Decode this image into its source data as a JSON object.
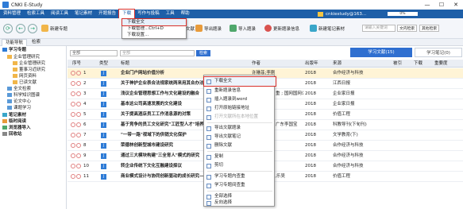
{
  "window": {
    "title": "CNKI E-Study",
    "minimize": "—",
    "maximize": "☐",
    "close": "✕"
  },
  "menu": {
    "items": [
      "资料管理",
      "检索工具",
      "阅读工具",
      "笔记素材",
      "开题报告",
      "下载",
      "写作与投稿",
      "工具",
      "帮助"
    ],
    "user": "cnkiestudy@163...",
    "progress": "0%"
  },
  "download_menu": {
    "items": [
      "下载全文",
      "下载管理...Ctrl+D",
      "下载设置..."
    ]
  },
  "toolbar": {
    "buttons": [
      "新建专题",
      "新建文件夹",
      "添加文献",
      "导入题录",
      "导出题录",
      "查找重复",
      "检索",
      "导出题录",
      "导入题录",
      "更新题录信息",
      "新建笔记素材"
    ],
    "search_placeholder": "请输入关键词",
    "search_btn": "文内检索",
    "other_search": "其他检索"
  },
  "tabs": {
    "items": [
      "功能导航",
      "检索"
    ]
  },
  "sidebar": {
    "items": [
      "学习专题",
      "企业管理研究",
      "企业管理研究",
      "董事习近研究",
      "网页资料",
      "已读文献",
      "全文检索",
      "科学知识图谱",
      "论文中心",
      "课题学习",
      "笔记素材",
      "临时阅读",
      "浏览器导入",
      "回收站"
    ]
  },
  "filter": {
    "select": "全部",
    "input_placeholder": "全部",
    "button": "检索",
    "pill_study": "学习文献(15)",
    "pill_notes": "学习笔记(0)"
  },
  "table": {
    "headers": [
      "序号",
      "类型",
      "标题",
      "作者",
      "出版年",
      "来源",
      "被引",
      "下载",
      "重要度"
    ],
    "rows": [
      {
        "no": "1",
        "type": "J",
        "title": "企业门户网站价值分析",
        "author": "许琳菲;李刚",
        "year": "2018",
        "source": "合作经济与科技"
      },
      {
        "no": "2",
        "type": "J",
        "title": "关于神护企业表合法规家统两来用其合办法",
        "author": "",
        "year": "2018",
        "source": "江西日报"
      },
      {
        "no": "3",
        "type": "J",
        "title": "浅议企业管理思想工作与文化建设的融合",
        "author": "重 ; 国网国网公司通信厂(集)",
        "year": "2018",
        "source": "企业家日报"
      },
      {
        "no": "4",
        "type": "J",
        "title": "基本这公司高速发展的文化建设",
        "author": "",
        "year": "2018",
        "source": "企业家日报"
      },
      {
        "no": "5",
        "type": "J",
        "title": "关于提高酒店员工工作消息源的对策",
        "author": "",
        "year": "2018",
        "source": "价值工程"
      },
      {
        "no": "6",
        "type": "J",
        "title": "基于竞争的员工文化研究\"工匠型人才\"培养",
        "author": "广东李国宝",
        "year": "2018",
        "source": "科教导刊(下旬刊)"
      },
      {
        "no": "7",
        "type": "J",
        "title": "\"一带一路\"视域下的供销文化保护",
        "author": "",
        "year": "2018",
        "source": "文学教育(下)"
      },
      {
        "no": "8",
        "type": "J",
        "title": "荣德林创新型城市建设研究",
        "author": "",
        "year": "2018",
        "source": "合作经济与科技"
      },
      {
        "no": "9",
        "type": "J",
        "title": "通过三大模块构建\"三全育人\"模式的研究",
        "author": "",
        "year": "2018",
        "source": "合作经济与科技"
      },
      {
        "no": "10",
        "type": "J",
        "title": "转企业传统下文化互融建设探议",
        "author": "",
        "year": "2018",
        "source": "合作经济与科技"
      },
      {
        "no": "11",
        "type": "J",
        "title": "商业模式设计与协同创新驱动的成长研究——以制造...",
        "author": "李一,陶晓雨,乐吴",
        "year": "2018",
        "source": "价值工程"
      }
    ]
  },
  "context_menu": {
    "items": [
      "下载全文",
      "重新题录信息",
      "插入题录到word",
      "打开原始链接地址",
      "打开文献所在本地位置",
      "导出文献题录",
      "导出文献笔记",
      "删除文献",
      "复制",
      "剪切",
      "学习专题内查重",
      "学习专题间查重",
      "全部选择",
      "反向选择"
    ]
  }
}
